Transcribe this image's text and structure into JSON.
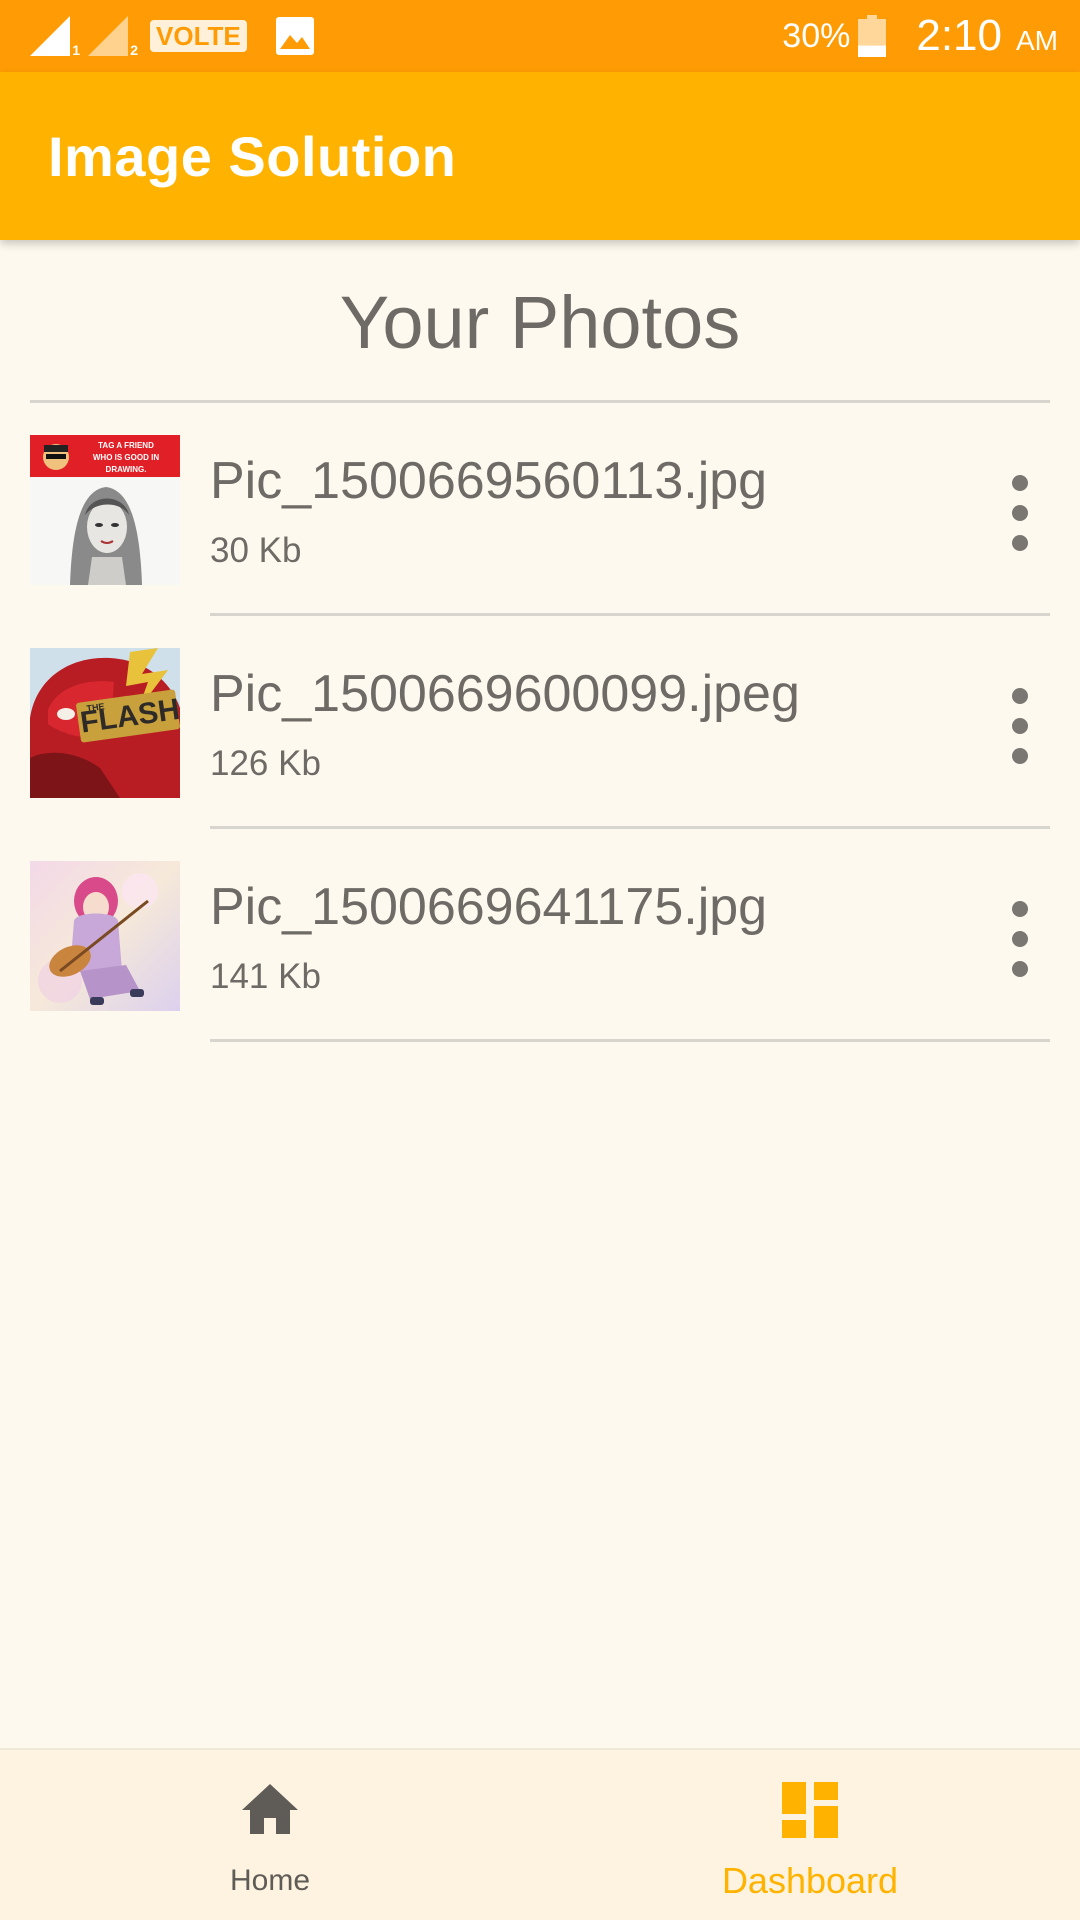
{
  "status_bar": {
    "sim1_label": "1",
    "sim2_label": "2",
    "volte_label": "VOLTE",
    "battery_percent": "30%",
    "battery_level": 0.3,
    "time": "2:10",
    "ampm": "AM",
    "icons": [
      "signal-sim1-icon",
      "signal-sim2-icon",
      "volte-icon",
      "image-notification-icon",
      "battery-icon"
    ]
  },
  "app_bar": {
    "title": "Image Solution",
    "color": "#ffb300"
  },
  "main": {
    "section_title": "Your Photos",
    "photos": [
      {
        "name": "Pic_1500669560113.jpg",
        "size": "30 Kb",
        "thumb_banner_text": [
          "TAG A FRIEND",
          "WHO IS GOOD IN",
          "DRAWING."
        ],
        "menu_icon": "more-vert-icon"
      },
      {
        "name": "Pic_1500669600099.jpeg",
        "size": "126 Kb",
        "thumb_banner_text": [
          "THE",
          "FLASH"
        ],
        "menu_icon": "more-vert-icon"
      },
      {
        "name": "Pic_1500669641175.jpg",
        "size": "141 Kb",
        "menu_icon": "more-vert-icon"
      }
    ]
  },
  "bottom_nav": {
    "items": [
      {
        "label": "Home",
        "icon": "home-icon",
        "active": false
      },
      {
        "label": "Dashboard",
        "icon": "dashboard-icon",
        "active": true
      }
    ],
    "active_color": "#ffb300",
    "inactive_color": "#5f5b57"
  }
}
